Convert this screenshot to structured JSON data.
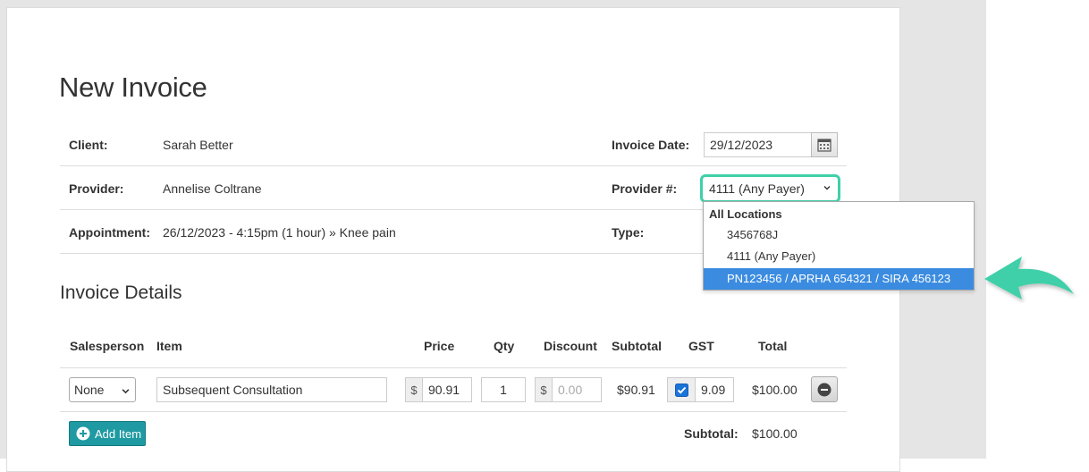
{
  "page": {
    "title": "New Invoice"
  },
  "client": {
    "label": "Client:",
    "value": "Sarah Better"
  },
  "invoice_date": {
    "label": "Invoice Date:",
    "value": "29/12/2023",
    "button_icon": "calendar-icon"
  },
  "provider": {
    "label": "Provider:",
    "value": "Annelise Coltrane"
  },
  "provider_number": {
    "label": "Provider #:",
    "selected": "4111 (Any Payer)",
    "dropdown": {
      "group_label": "All Locations",
      "options": [
        "3456768J",
        "4111 (Any Payer)",
        "PN123456 / APRHA 654321 / SIRA 456123"
      ],
      "highlighted_index": 2
    }
  },
  "appointment": {
    "label": "Appointment:",
    "value": "26/12/2023 - 4:15pm (1 hour) » Knee pain"
  },
  "type": {
    "label": "Type:"
  },
  "invoice_details": {
    "title": "Invoice Details",
    "columns": [
      "Salesperson",
      "Item",
      "Price",
      "Qty",
      "Discount",
      "Subtotal",
      "GST",
      "Total"
    ],
    "rows": [
      {
        "salesperson": "None",
        "item": "Subsequent Consultation",
        "currency_symbol": "$",
        "price": "90.91",
        "qty": "1",
        "discount_placeholder": "0.00",
        "subtotal": "$90.91",
        "gst_checked": true,
        "gst": "9.09",
        "total": "$100.00"
      }
    ],
    "add_item_label": "Add Item",
    "subtotal_label": "Subtotal:",
    "subtotal_value": "$100.00"
  },
  "colors": {
    "highlight_border": "#3fd0a9",
    "arrow": "#3fd0a9",
    "dropdown_selected": "#3b8ce0",
    "add_button": "#1f9aa2"
  }
}
